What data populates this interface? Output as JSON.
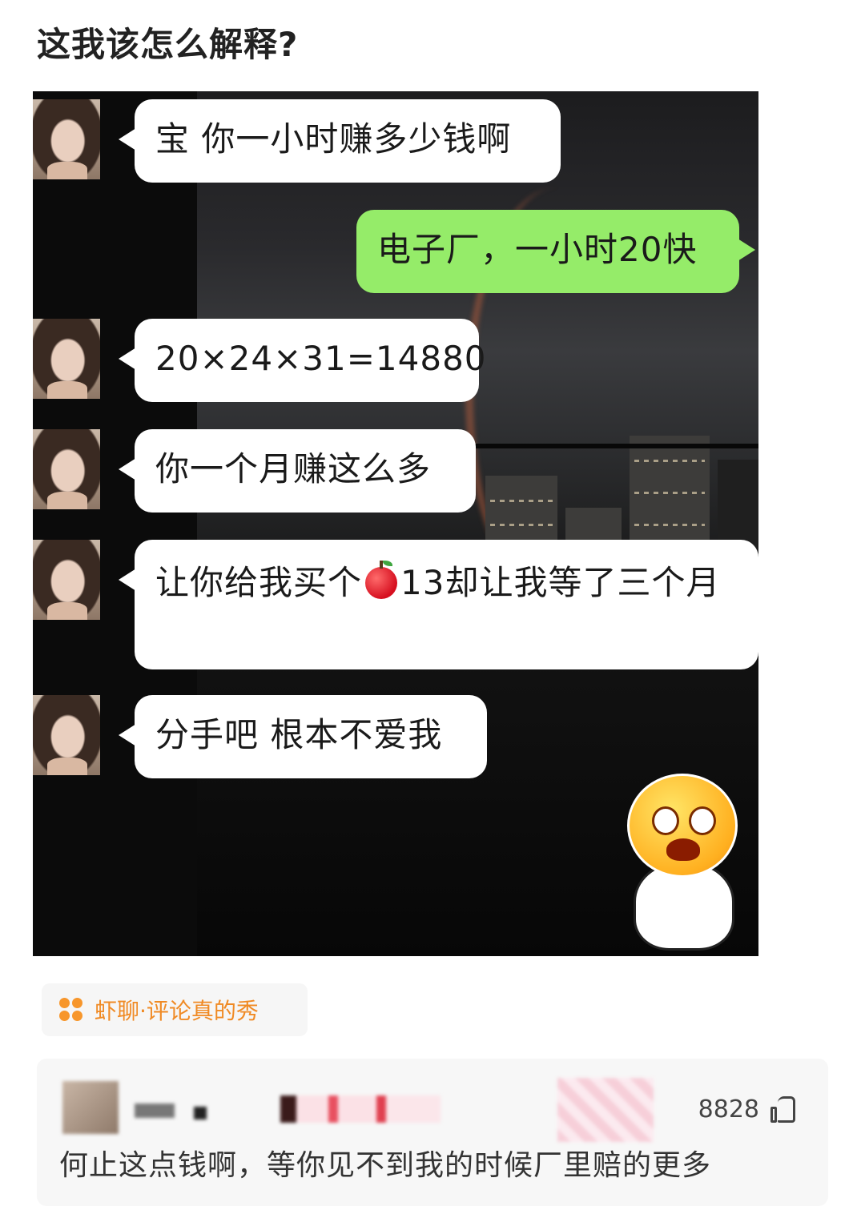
{
  "post": {
    "title": "这我该怎么解释?"
  },
  "chat": {
    "messages": [
      {
        "side": "left",
        "text": "宝 你一小时赚多少钱啊"
      },
      {
        "side": "right",
        "text": "电子厂，一小时20快"
      },
      {
        "side": "left",
        "text": "20×24×31=14880"
      },
      {
        "side": "left",
        "text": "你一个月赚这么多"
      },
      {
        "side": "left",
        "text_before": "让你给我买个",
        "emoji": "apple-emoji",
        "text_after": "13却让我等了三个月"
      },
      {
        "side": "left",
        "text": "分手吧 根本不爱我"
      }
    ],
    "sticker": "crying-face-sticker",
    "colors": {
      "outgoing_bubble": "#95ec69",
      "incoming_bubble": "#ffffff"
    }
  },
  "source_tag": {
    "text": "虾聊·评论真的秀",
    "color": "#f08a24"
  },
  "comment": {
    "likes": "8828",
    "text": "何止这点钱啊，等你见不到我的时候厂里赔的更多"
  }
}
